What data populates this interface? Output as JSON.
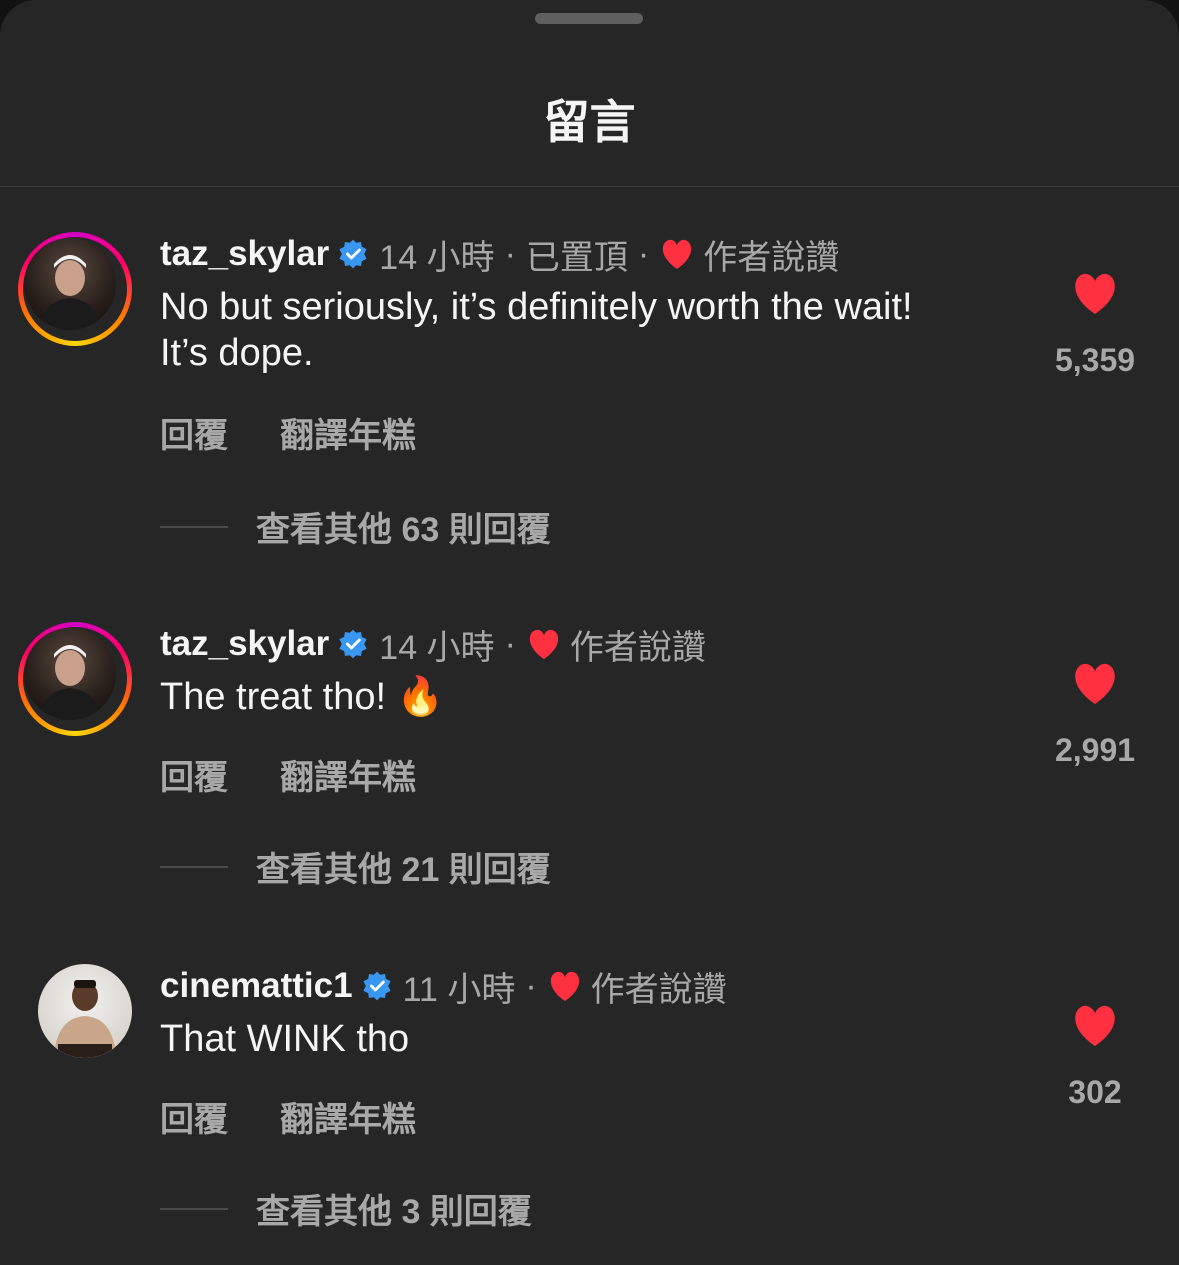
{
  "sheet": {
    "title": "留言"
  },
  "comments": [
    {
      "username": "taz_skylar",
      "time": "14 小時",
      "pinned": "已置頂",
      "liked_by_author": "作者說讚",
      "text": "No but seriously, it’s definitely worth the wait! It’s dope.",
      "likes": "5,359",
      "reply_label": "回覆",
      "translate_label": "翻譯年糕",
      "view_replies": "查看其他 63 則回覆"
    },
    {
      "username": "taz_skylar",
      "time": "14 小時",
      "liked_by_author": "作者說讚",
      "text": "The treat tho! 🔥",
      "likes": "2,991",
      "reply_label": "回覆",
      "translate_label": "翻譯年糕",
      "view_replies": "查看其他 21 則回覆"
    },
    {
      "username": "cinemattic1",
      "time": "11 小時",
      "liked_by_author": "作者說讚",
      "text": "That WINK tho",
      "likes": "302",
      "reply_label": "回覆",
      "translate_label": "翻譯年糕",
      "view_replies": "查看其他 3 則回覆"
    }
  ],
  "colors": {
    "background": "#262626",
    "heart": "#ff3040",
    "verified": "#3897f0",
    "muted_text": "#a8a8a8"
  },
  "icons": {
    "verified": "verified-badge-icon",
    "heart": "heart-icon"
  }
}
